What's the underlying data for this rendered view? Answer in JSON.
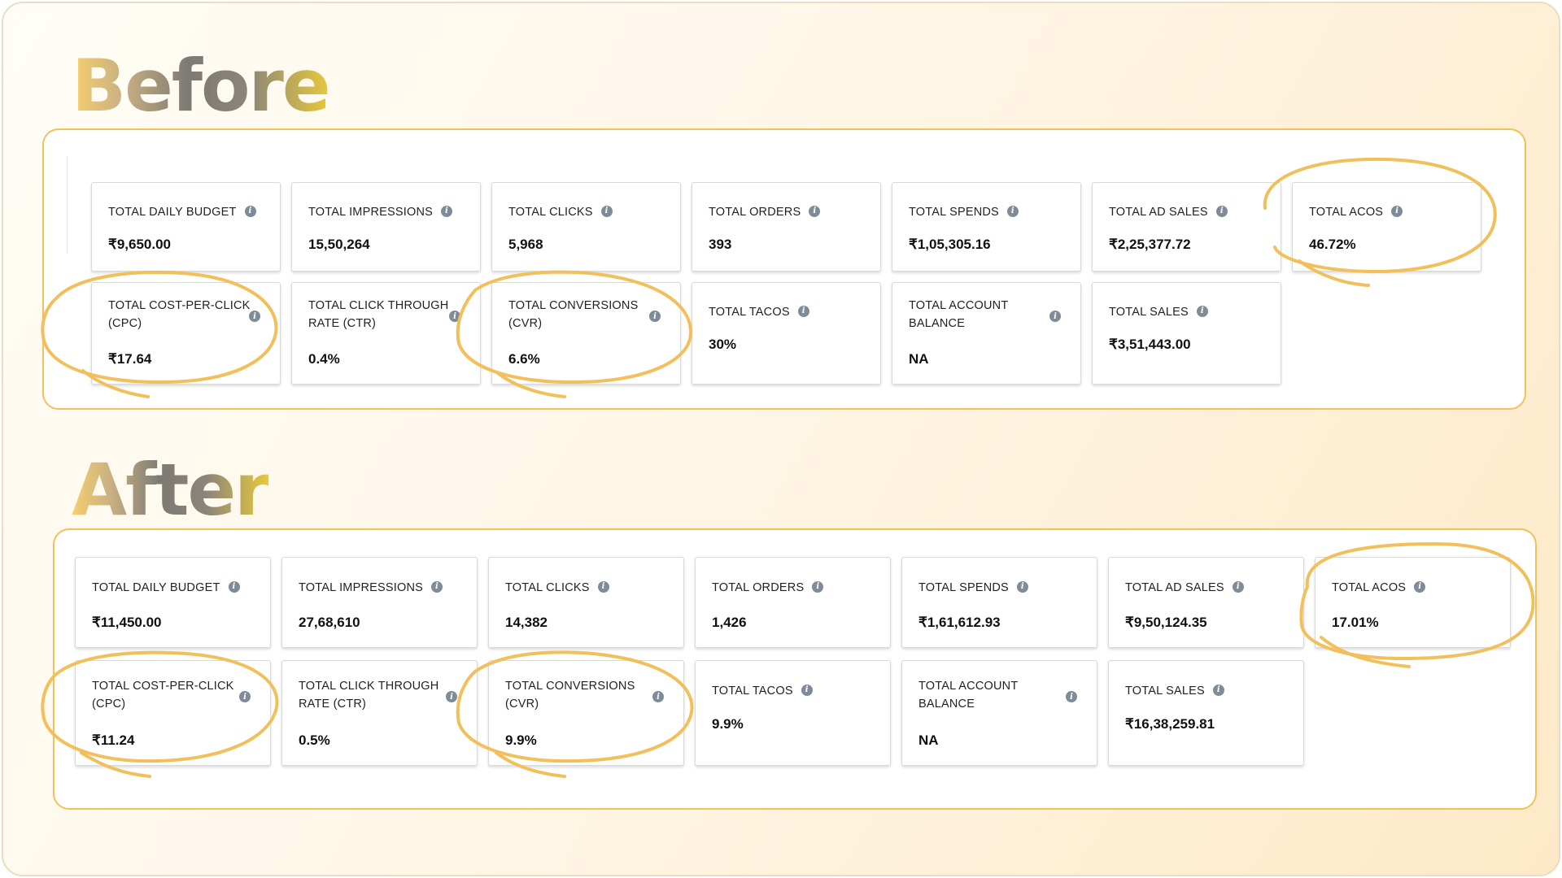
{
  "before": {
    "heading": "Before",
    "row1": [
      {
        "label": "TOTAL DAILY BUDGET",
        "value": "₹9,650.00"
      },
      {
        "label": "TOTAL IMPRESSIONS",
        "value": "15,50,264"
      },
      {
        "label": "TOTAL CLICKS",
        "value": "5,968"
      },
      {
        "label": "TOTAL ORDERS",
        "value": "393"
      },
      {
        "label": "TOTAL SPENDS",
        "value": "₹1,05,305.16"
      },
      {
        "label": "TOTAL AD SALES",
        "value": "₹2,25,377.72"
      },
      {
        "label": "TOTAL ACOS",
        "value": "46.72%"
      }
    ],
    "row2": [
      {
        "label_line1": "TOTAL COST-PER-CLICK",
        "label_line2": "(CPC)",
        "value": "₹17.64"
      },
      {
        "label_line1": "TOTAL CLICK THROUGH",
        "label_line2": "RATE (CTR)",
        "value": "0.4%"
      },
      {
        "label_line1": "TOTAL CONVERSIONS",
        "label_line2": "(CVR)",
        "value": "6.6%"
      },
      {
        "label": "TOTAL TACOS",
        "value": "30%"
      },
      {
        "label_line1": "TOTAL ACCOUNT",
        "label_line2": "BALANCE",
        "value": "NA"
      },
      {
        "label": "TOTAL SALES",
        "value": "₹3,51,443.00"
      }
    ]
  },
  "after": {
    "heading": "After",
    "row1": [
      {
        "label": "TOTAL DAILY BUDGET",
        "value": "₹11,450.00"
      },
      {
        "label": "TOTAL IMPRESSIONS",
        "value": "27,68,610"
      },
      {
        "label": "TOTAL CLICKS",
        "value": "14,382"
      },
      {
        "label": "TOTAL ORDERS",
        "value": "1,426"
      },
      {
        "label": "TOTAL SPENDS",
        "value": "₹1,61,612.93"
      },
      {
        "label": "TOTAL AD SALES",
        "value": "₹9,50,124.35"
      },
      {
        "label": "TOTAL ACOS",
        "value": "17.01%"
      }
    ],
    "row2": [
      {
        "label_line1": "TOTAL COST-PER-CLICK",
        "label_line2": "(CPC)",
        "value": "₹11.24"
      },
      {
        "label_line1": "TOTAL CLICK THROUGH",
        "label_line2": "RATE (CTR)",
        "value": "0.5%"
      },
      {
        "label_line1": "TOTAL CONVERSIONS",
        "label_line2": "(CVR)",
        "value": "9.9%"
      },
      {
        "label": "TOTAL TACOS",
        "value": "9.9%"
      },
      {
        "label_line1": "TOTAL ACCOUNT",
        "label_line2": "BALANCE",
        "value": "NA"
      },
      {
        "label": "TOTAL SALES",
        "value": "₹16,38,259.81"
      }
    ]
  },
  "icons": {
    "info": "info-icon",
    "highlight": "hand-drawn-ellipse"
  },
  "colors": {
    "highlight": "#f1bf5c",
    "panel_border": "#f2c15a",
    "info_icon": "#7f8b99"
  }
}
